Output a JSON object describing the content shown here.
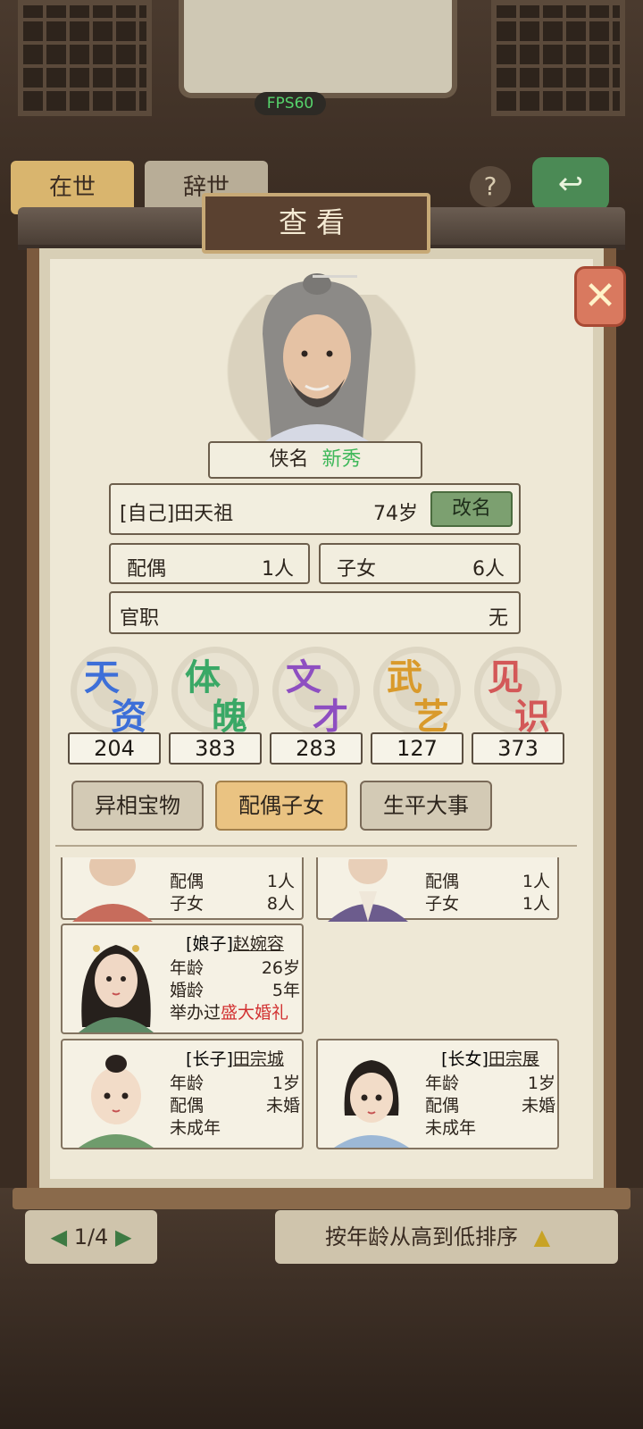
{
  "status": {
    "fps": "FPS60"
  },
  "bg_tabs": [
    "在世",
    "辞世"
  ],
  "dialog": {
    "title": "查看"
  },
  "hero": {
    "title_label": "侠名",
    "title_value": "新秀",
    "name": "[自己]田天祖",
    "age": "74岁",
    "rename_label": "改名",
    "spouse_label": "配偶",
    "spouse_value": "1人",
    "children_label": "子女",
    "children_value": "6人",
    "office_label": "官职",
    "office_value": "无"
  },
  "attributes": [
    {
      "c1": "天",
      "c2": "资",
      "value": "204",
      "color": "#3d6fd8"
    },
    {
      "c1": "体",
      "c2": "魄",
      "value": "383",
      "color": "#3aa866"
    },
    {
      "c1": "文",
      "c2": "才",
      "value": "283",
      "color": "#8e4fc1"
    },
    {
      "c1": "武",
      "c2": "艺",
      "value": "127",
      "color": "#d99a2b"
    },
    {
      "c1": "见",
      "c2": "识",
      "value": "373",
      "color": "#d35858"
    }
  ],
  "tabs": [
    {
      "label": "异相宝物",
      "active": false
    },
    {
      "label": "配偶子女",
      "active": true
    },
    {
      "label": "生平大事",
      "active": false
    }
  ],
  "family": {
    "partial_left": {
      "spouse_label": "配偶",
      "spouse": "1人",
      "children_label": "子女",
      "children": "8人"
    },
    "partial_right": {
      "spouse_label": "配偶",
      "spouse": "1人",
      "children_label": "子女",
      "children": "1人"
    },
    "wife": {
      "role": "[娘子]",
      "name": "赵婉容",
      "age_label": "年龄",
      "age": "26岁",
      "marriage_label": "婚龄",
      "marriage": "5年",
      "wedding_prefix": "举办过",
      "wedding": "盛大婚礼"
    },
    "son": {
      "role": "[长子]",
      "name": "田宗城",
      "age_label": "年龄",
      "age": "1岁",
      "spouse_label": "配偶",
      "spouse": "未婚",
      "status": "未成年"
    },
    "daughter": {
      "role": "[长女]",
      "name": "田宗展",
      "age_label": "年龄",
      "age": "1岁",
      "spouse_label": "配偶",
      "spouse": "未婚",
      "status": "未成年"
    }
  },
  "footer": {
    "page": "1/4",
    "sort": "按年龄从高到低排序"
  }
}
